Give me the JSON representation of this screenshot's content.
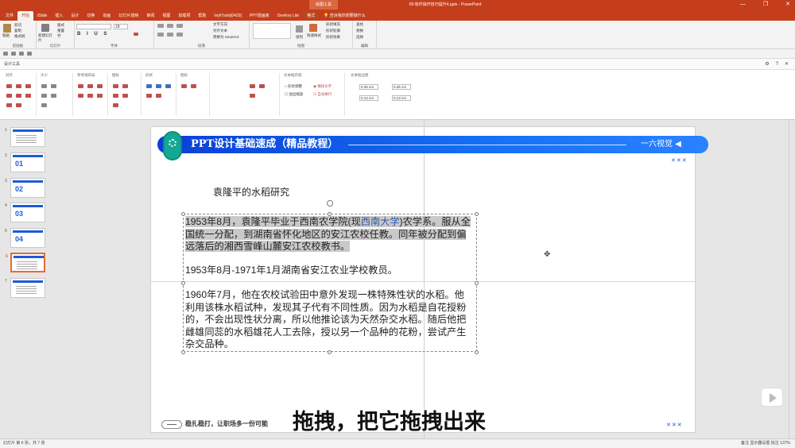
{
  "titlebar": {
    "contextual_tool": "绘图工具",
    "document_title": "09-软件操作技巧提升4.pptx - PowerPoint"
  },
  "tabs": [
    "文件",
    "开始",
    "iSlide",
    "插入",
    "设计",
    "切换",
    "动画",
    "幻灯片放映",
    "审阅",
    "视图",
    "加载项",
    "帮助",
    "lvyhTools[0429]",
    "PPT插画家",
    "OneKey Lite",
    "格式"
  ],
  "tell_me": "告诉我你想要做什么",
  "ribbon_groups": [
    "剪贴板",
    "幻灯片",
    "字体",
    "段落",
    "绘图",
    "编辑"
  ],
  "ribbon_labels": {
    "paste": "粘贴",
    "cut": "剪切",
    "copy": "复制",
    "format_painter": "格式刷",
    "new_slide": "新建幻灯片",
    "layout": "版式",
    "reset": "重置",
    "section": "节",
    "font_size": "18",
    "text_direction": "文字方向",
    "align_text": "对齐文本",
    "convert_smartart": "转换为 SmartArt",
    "arrange": "排列",
    "quick_styles": "快速样式",
    "shape_fill": "形状填充",
    "shape_outline": "形状轮廓",
    "shape_effects": "形状效果",
    "find": "查找",
    "replace": "替换",
    "select": "选择"
  },
  "design_tools_label": "设计工具",
  "pane2": {
    "groups": [
      "对齐",
      "大小",
      "参考线布局",
      "图标",
      "形状",
      "图形",
      "文本框内容",
      "文本框边距"
    ],
    "opts": {
      "shrink": "形状调整",
      "wrap": "横排文字",
      "overflow": "溢出缩放",
      "autowrap": "自动换行"
    },
    "margins": [
      "0.25 cm",
      "0.25 cm",
      "0.13 cm",
      "0.13 cm"
    ]
  },
  "thumbnails": [
    "1",
    "2",
    "3",
    "4",
    "5",
    "6",
    "7"
  ],
  "thumb_big": [
    "01",
    "02",
    "03",
    "04"
  ],
  "slide": {
    "banner_title": "PPT设计基础速成（精品教程）",
    "banner_right": "一六视觉 ◀",
    "marks_top": "✕✕✕",
    "marks_bottom": "✕✕✕",
    "heading": "袁隆平的水稻研究",
    "p1_a": "1953年8月，袁隆平毕业于西南农学院(现",
    "p1_link": "西南大学",
    "p1_b": ")农学系。服从全国统一分配，到湖南省怀化地区的安江农校任教。同年被分配到偏远落后的湘西雪峰山麓安江农校教书。",
    "p2": "1953年8月-1971年1月湖南省安江农业学校教员。",
    "p3": "1960年7月，他在农校试验田中意外发现一株特殊性状的水稻。他利用该株水稻试种，发现其子代有不同性质。因为水稻是自花授粉的，不会出现性状分离，所以他推论该为天然杂交水稻。随后他把雌雄同蕊的水稻雄花人工去除，授以另一个品种的花粉，尝试产生杂交品种。",
    "footer": "稳扎稳打，让职场多一份可能"
  },
  "caption": "拖拽，把它拖拽出来",
  "status": {
    "left": "幻灯片 第 6 张，共 7 张",
    "right": "备注   显示器设置   批注   137%"
  }
}
